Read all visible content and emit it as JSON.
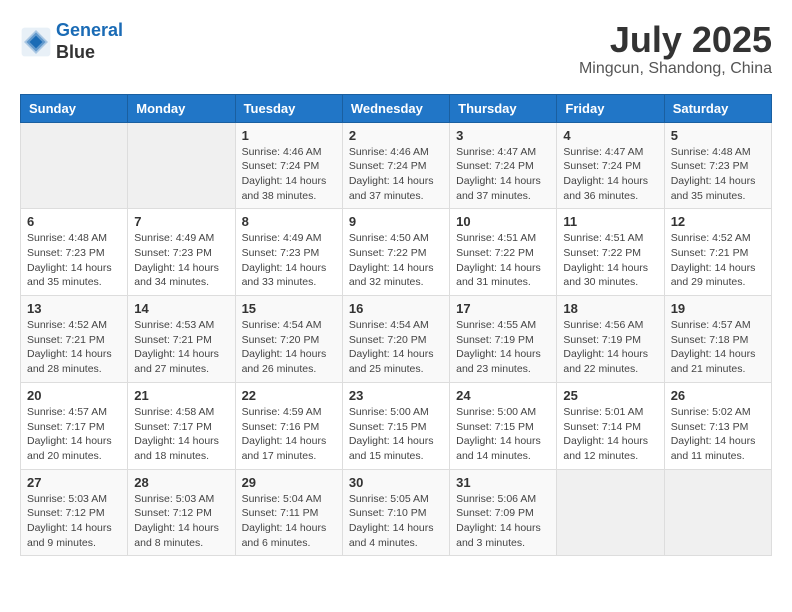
{
  "logo": {
    "line1": "General",
    "line2": "Blue"
  },
  "title": "July 2025",
  "subtitle": "Mingcun, Shandong, China",
  "headers": [
    "Sunday",
    "Monday",
    "Tuesday",
    "Wednesday",
    "Thursday",
    "Friday",
    "Saturday"
  ],
  "weeks": [
    [
      {
        "day": "",
        "sunrise": "",
        "sunset": "",
        "daylight": "",
        "empty": true
      },
      {
        "day": "",
        "sunrise": "",
        "sunset": "",
        "daylight": "",
        "empty": true
      },
      {
        "day": "1",
        "sunrise": "Sunrise: 4:46 AM",
        "sunset": "Sunset: 7:24 PM",
        "daylight": "Daylight: 14 hours and 38 minutes."
      },
      {
        "day": "2",
        "sunrise": "Sunrise: 4:46 AM",
        "sunset": "Sunset: 7:24 PM",
        "daylight": "Daylight: 14 hours and 37 minutes."
      },
      {
        "day": "3",
        "sunrise": "Sunrise: 4:47 AM",
        "sunset": "Sunset: 7:24 PM",
        "daylight": "Daylight: 14 hours and 37 minutes."
      },
      {
        "day": "4",
        "sunrise": "Sunrise: 4:47 AM",
        "sunset": "Sunset: 7:24 PM",
        "daylight": "Daylight: 14 hours and 36 minutes."
      },
      {
        "day": "5",
        "sunrise": "Sunrise: 4:48 AM",
        "sunset": "Sunset: 7:23 PM",
        "daylight": "Daylight: 14 hours and 35 minutes."
      }
    ],
    [
      {
        "day": "6",
        "sunrise": "Sunrise: 4:48 AM",
        "sunset": "Sunset: 7:23 PM",
        "daylight": "Daylight: 14 hours and 35 minutes."
      },
      {
        "day": "7",
        "sunrise": "Sunrise: 4:49 AM",
        "sunset": "Sunset: 7:23 PM",
        "daylight": "Daylight: 14 hours and 34 minutes."
      },
      {
        "day": "8",
        "sunrise": "Sunrise: 4:49 AM",
        "sunset": "Sunset: 7:23 PM",
        "daylight": "Daylight: 14 hours and 33 minutes."
      },
      {
        "day": "9",
        "sunrise": "Sunrise: 4:50 AM",
        "sunset": "Sunset: 7:22 PM",
        "daylight": "Daylight: 14 hours and 32 minutes."
      },
      {
        "day": "10",
        "sunrise": "Sunrise: 4:51 AM",
        "sunset": "Sunset: 7:22 PM",
        "daylight": "Daylight: 14 hours and 31 minutes."
      },
      {
        "day": "11",
        "sunrise": "Sunrise: 4:51 AM",
        "sunset": "Sunset: 7:22 PM",
        "daylight": "Daylight: 14 hours and 30 minutes."
      },
      {
        "day": "12",
        "sunrise": "Sunrise: 4:52 AM",
        "sunset": "Sunset: 7:21 PM",
        "daylight": "Daylight: 14 hours and 29 minutes."
      }
    ],
    [
      {
        "day": "13",
        "sunrise": "Sunrise: 4:52 AM",
        "sunset": "Sunset: 7:21 PM",
        "daylight": "Daylight: 14 hours and 28 minutes."
      },
      {
        "day": "14",
        "sunrise": "Sunrise: 4:53 AM",
        "sunset": "Sunset: 7:21 PM",
        "daylight": "Daylight: 14 hours and 27 minutes."
      },
      {
        "day": "15",
        "sunrise": "Sunrise: 4:54 AM",
        "sunset": "Sunset: 7:20 PM",
        "daylight": "Daylight: 14 hours and 26 minutes."
      },
      {
        "day": "16",
        "sunrise": "Sunrise: 4:54 AM",
        "sunset": "Sunset: 7:20 PM",
        "daylight": "Daylight: 14 hours and 25 minutes."
      },
      {
        "day": "17",
        "sunrise": "Sunrise: 4:55 AM",
        "sunset": "Sunset: 7:19 PM",
        "daylight": "Daylight: 14 hours and 23 minutes."
      },
      {
        "day": "18",
        "sunrise": "Sunrise: 4:56 AM",
        "sunset": "Sunset: 7:19 PM",
        "daylight": "Daylight: 14 hours and 22 minutes."
      },
      {
        "day": "19",
        "sunrise": "Sunrise: 4:57 AM",
        "sunset": "Sunset: 7:18 PM",
        "daylight": "Daylight: 14 hours and 21 minutes."
      }
    ],
    [
      {
        "day": "20",
        "sunrise": "Sunrise: 4:57 AM",
        "sunset": "Sunset: 7:17 PM",
        "daylight": "Daylight: 14 hours and 20 minutes."
      },
      {
        "day": "21",
        "sunrise": "Sunrise: 4:58 AM",
        "sunset": "Sunset: 7:17 PM",
        "daylight": "Daylight: 14 hours and 18 minutes."
      },
      {
        "day": "22",
        "sunrise": "Sunrise: 4:59 AM",
        "sunset": "Sunset: 7:16 PM",
        "daylight": "Daylight: 14 hours and 17 minutes."
      },
      {
        "day": "23",
        "sunrise": "Sunrise: 5:00 AM",
        "sunset": "Sunset: 7:15 PM",
        "daylight": "Daylight: 14 hours and 15 minutes."
      },
      {
        "day": "24",
        "sunrise": "Sunrise: 5:00 AM",
        "sunset": "Sunset: 7:15 PM",
        "daylight": "Daylight: 14 hours and 14 minutes."
      },
      {
        "day": "25",
        "sunrise": "Sunrise: 5:01 AM",
        "sunset": "Sunset: 7:14 PM",
        "daylight": "Daylight: 14 hours and 12 minutes."
      },
      {
        "day": "26",
        "sunrise": "Sunrise: 5:02 AM",
        "sunset": "Sunset: 7:13 PM",
        "daylight": "Daylight: 14 hours and 11 minutes."
      }
    ],
    [
      {
        "day": "27",
        "sunrise": "Sunrise: 5:03 AM",
        "sunset": "Sunset: 7:12 PM",
        "daylight": "Daylight: 14 hours and 9 minutes."
      },
      {
        "day": "28",
        "sunrise": "Sunrise: 5:03 AM",
        "sunset": "Sunset: 7:12 PM",
        "daylight": "Daylight: 14 hours and 8 minutes."
      },
      {
        "day": "29",
        "sunrise": "Sunrise: 5:04 AM",
        "sunset": "Sunset: 7:11 PM",
        "daylight": "Daylight: 14 hours and 6 minutes."
      },
      {
        "day": "30",
        "sunrise": "Sunrise: 5:05 AM",
        "sunset": "Sunset: 7:10 PM",
        "daylight": "Daylight: 14 hours and 4 minutes."
      },
      {
        "day": "31",
        "sunrise": "Sunrise: 5:06 AM",
        "sunset": "Sunset: 7:09 PM",
        "daylight": "Daylight: 14 hours and 3 minutes."
      },
      {
        "day": "",
        "sunrise": "",
        "sunset": "",
        "daylight": "",
        "empty": true
      },
      {
        "day": "",
        "sunrise": "",
        "sunset": "",
        "daylight": "",
        "empty": true
      }
    ]
  ]
}
